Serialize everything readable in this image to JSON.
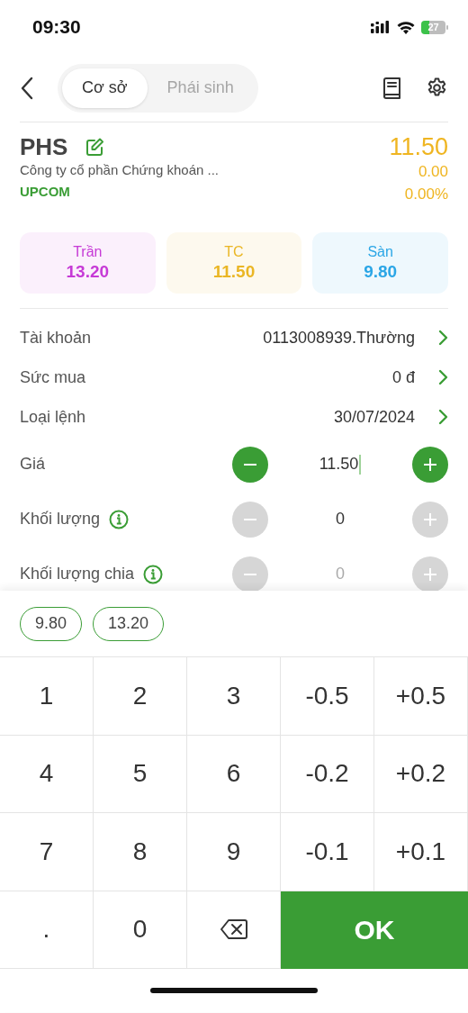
{
  "status_bar": {
    "time": "09:30",
    "battery": "27"
  },
  "nav": {
    "tabs": [
      {
        "label": "Cơ sở",
        "selected": true
      },
      {
        "label": "Phái sinh",
        "selected": false
      }
    ]
  },
  "stock": {
    "symbol": "PHS",
    "name": "Công ty cổ phần Chứng khoán ...",
    "exchange": "UPCOM",
    "price": "11.50",
    "change": "0.00",
    "change_percent": "0.00%"
  },
  "price_levels": [
    {
      "label": "Trần",
      "value": "13.20",
      "color": "#c63ad6"
    },
    {
      "label": "TC",
      "value": "11.50",
      "color": "#eab624"
    },
    {
      "label": "Sàn",
      "value": "9.80",
      "color": "#2ba6e6"
    }
  ],
  "form": [
    {
      "kind": "link",
      "label": "Tài khoản",
      "value": "0113008939.Thường"
    },
    {
      "kind": "link",
      "label": "Sức mua",
      "value": "0 đ"
    },
    {
      "kind": "link",
      "label": "Loại lệnh",
      "value": "30/07/2024"
    },
    {
      "kind": "stepper",
      "label": "Giá",
      "value": "11.50",
      "info": false,
      "enabled": true,
      "focused": true
    },
    {
      "kind": "stepper",
      "label": "Khối lượng",
      "value": "0",
      "info": true,
      "enabled": false,
      "focused": false
    },
    {
      "kind": "stepper",
      "label": "Khối lượng chia",
      "placeholder": "0",
      "info": true,
      "enabled": false,
      "focused": false
    }
  ],
  "quick_prices": [
    "9.80",
    "13.20"
  ],
  "keypad": [
    {
      "kind": "key",
      "label": "1"
    },
    {
      "kind": "key",
      "label": "2"
    },
    {
      "kind": "key",
      "label": "3"
    },
    {
      "kind": "key",
      "label": "-0.5"
    },
    {
      "kind": "key",
      "label": "+0.5"
    },
    {
      "kind": "key",
      "label": "4"
    },
    {
      "kind": "key",
      "label": "5"
    },
    {
      "kind": "key",
      "label": "6"
    },
    {
      "kind": "key",
      "label": "-0.2"
    },
    {
      "kind": "key",
      "label": "+0.2"
    },
    {
      "kind": "key",
      "label": "7"
    },
    {
      "kind": "key",
      "label": "8"
    },
    {
      "kind": "key",
      "label": "9"
    },
    {
      "kind": "key",
      "label": "-0.1"
    },
    {
      "kind": "key",
      "label": "+0.1"
    },
    {
      "kind": "key",
      "label": "."
    },
    {
      "kind": "key",
      "label": "0"
    },
    {
      "kind": "backspace"
    },
    {
      "kind": "ok",
      "label": "OK"
    }
  ]
}
